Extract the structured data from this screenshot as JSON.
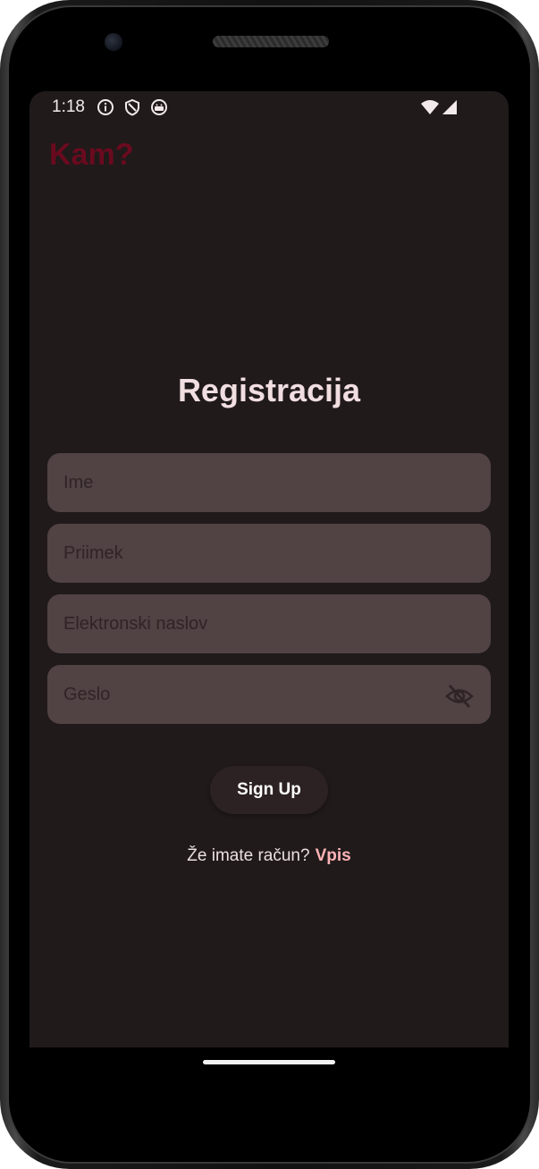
{
  "status_bar": {
    "time": "1:18",
    "icons": [
      "info-icon",
      "shield-icon",
      "android-icon"
    ],
    "right_icons": [
      "wifi-icon",
      "signal-icon"
    ]
  },
  "app": {
    "title": "Kam?",
    "title_color": "#6a0a1e"
  },
  "form": {
    "title": "Registracija",
    "fields": {
      "first_name": {
        "placeholder": "Ime",
        "value": ""
      },
      "last_name": {
        "placeholder": "Priimek",
        "value": ""
      },
      "email": {
        "placeholder": "Elektronski naslov",
        "value": ""
      },
      "password": {
        "placeholder": "Geslo",
        "value": "",
        "toggle_icon": "eye-off-icon"
      }
    },
    "submit_label": "Sign Up",
    "login_prompt": "Že imate račun?",
    "login_link": "Vpis"
  },
  "colors": {
    "background": "#201a1b",
    "field_fill": "#514243",
    "link": "#ffb3b6",
    "button": "#2c2223"
  }
}
